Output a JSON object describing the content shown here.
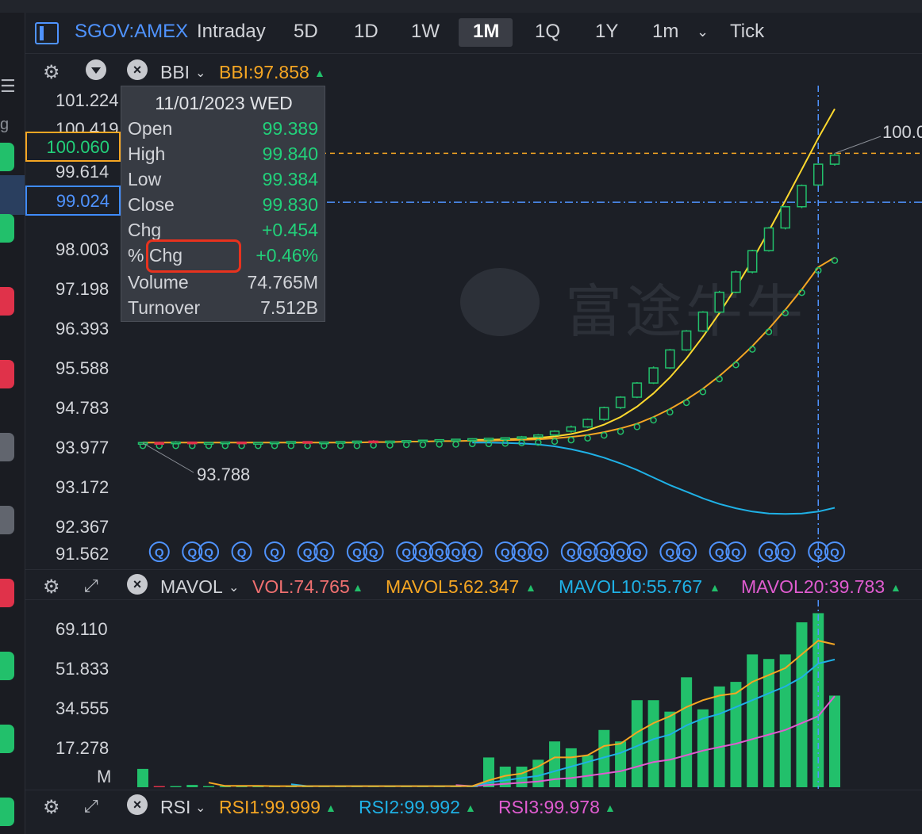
{
  "toolbar": {
    "symbol": "SGOV:AMEX",
    "timeframes": [
      "Intraday",
      "5D",
      "1D",
      "1W",
      "1M",
      "1Q",
      "1Y",
      "1m",
      "Tick"
    ],
    "active_timeframe": "1M"
  },
  "rail": {
    "menu_glyph": "☰",
    "letter": "g"
  },
  "price_panel": {
    "indicator": "BBI",
    "indicator_value": "BBI:97.858",
    "y_ticks": [
      "101.224",
      "100.419",
      "99.614",
      "98.003",
      "97.198",
      "96.393",
      "95.588",
      "94.783",
      "93.977",
      "93.172",
      "92.367",
      "91.562"
    ],
    "high_tag": "100.060",
    "low_tag": "99.024",
    "min_label": "93.788",
    "max_label": "100.0",
    "watermark": "富途牛牛"
  },
  "tooltip": {
    "date": "11/01/2023 WED",
    "rows": [
      {
        "label": "Open",
        "value": "99.389"
      },
      {
        "label": "High",
        "value": "99.840"
      },
      {
        "label": "Low",
        "value": "99.384"
      },
      {
        "label": "Close",
        "value": "99.830"
      },
      {
        "label": "Chg",
        "value": "+0.454"
      },
      {
        "label": "% Chg",
        "value": "+0.46%"
      },
      {
        "label": "Volume",
        "value": "74.765M"
      },
      {
        "label": "Turnover",
        "value": "7.512B"
      }
    ]
  },
  "vol_panel": {
    "indicator": "MAVOL",
    "vol": "VOL:74.765",
    "mavol5": "MAVOL5:62.347",
    "mavol10": "MAVOL10:55.767",
    "mavol20": "MAVOL20:39.783",
    "y_ticks": [
      "69.110",
      "51.833",
      "34.555",
      "17.278",
      "M"
    ]
  },
  "rsi_panel": {
    "indicator": "RSI",
    "rsi1": "RSI1:99.999",
    "rsi2": "RSI2:99.992",
    "rsi3": "RSI3:99.978"
  },
  "colors": {
    "up": "#22c06b",
    "down": "#e0324a",
    "accent": "#4f93ff",
    "orange": "#f5a623",
    "cyan": "#1fb1e6",
    "pink": "#e05cd0",
    "yellow": "#ffd92e"
  },
  "chart_data": {
    "type": "candlestick",
    "price_panel": {
      "ylim": [
        91.562,
        101.224
      ],
      "candles": [
        [
          93.93,
          93.95,
          93.9,
          93.94
        ],
        [
          93.94,
          93.96,
          93.91,
          93.93
        ],
        [
          93.93,
          93.97,
          93.9,
          93.95
        ],
        [
          93.95,
          93.96,
          93.9,
          93.93
        ],
        [
          93.93,
          93.95,
          93.91,
          93.94
        ],
        [
          93.94,
          93.96,
          93.92,
          93.95
        ],
        [
          93.95,
          93.96,
          93.92,
          93.93
        ],
        [
          93.93,
          93.95,
          93.91,
          93.94
        ],
        [
          93.94,
          93.96,
          93.92,
          93.95
        ],
        [
          93.95,
          93.97,
          93.93,
          93.96
        ],
        [
          93.96,
          93.97,
          93.93,
          93.94
        ],
        [
          93.94,
          93.96,
          93.92,
          93.95
        ],
        [
          93.95,
          93.97,
          93.93,
          93.96
        ],
        [
          93.96,
          93.98,
          93.94,
          93.97
        ],
        [
          93.97,
          93.99,
          93.95,
          93.96
        ],
        [
          93.96,
          93.98,
          93.94,
          93.97
        ],
        [
          93.97,
          93.99,
          93.95,
          93.98
        ],
        [
          93.98,
          94.0,
          93.96,
          93.99
        ],
        [
          93.99,
          94.01,
          93.97,
          94.0
        ],
        [
          94.0,
          94.02,
          93.98,
          94.01
        ],
        [
          94.01,
          94.03,
          93.99,
          94.02
        ],
        [
          94.02,
          94.04,
          94.0,
          94.03
        ],
        [
          94.03,
          94.05,
          94.01,
          94.04
        ],
        [
          94.04,
          94.08,
          94.02,
          94.06
        ],
        [
          94.06,
          94.12,
          94.04,
          94.1
        ],
        [
          94.1,
          94.2,
          94.08,
          94.18
        ],
        [
          94.18,
          94.3,
          94.15,
          94.27
        ],
        [
          94.27,
          94.45,
          94.25,
          94.43
        ],
        [
          94.43,
          94.7,
          94.4,
          94.68
        ],
        [
          94.68,
          94.92,
          94.65,
          94.9
        ],
        [
          94.9,
          95.22,
          94.88,
          95.2
        ],
        [
          95.2,
          95.55,
          95.18,
          95.52
        ],
        [
          95.52,
          95.92,
          95.5,
          95.9
        ],
        [
          95.9,
          96.32,
          95.88,
          96.3
        ],
        [
          96.3,
          96.72,
          96.28,
          96.7
        ],
        [
          96.7,
          97.15,
          96.68,
          97.12
        ],
        [
          97.12,
          97.58,
          97.1,
          97.55
        ],
        [
          97.55,
          98.02,
          97.52,
          98.0
        ],
        [
          98.0,
          98.5,
          97.98,
          98.48
        ],
        [
          98.48,
          98.95,
          98.45,
          98.93
        ],
        [
          98.93,
          99.4,
          98.9,
          99.38
        ],
        [
          99.389,
          99.84,
          99.384,
          99.83
        ],
        [
          99.83,
          100.06,
          99.8,
          100.02
        ]
      ],
      "bbi": [
        93.94,
        93.94,
        93.94,
        93.94,
        93.94,
        93.94,
        93.94,
        93.94,
        93.94,
        93.94,
        93.94,
        93.94,
        93.94,
        93.94,
        93.95,
        93.95,
        93.96,
        93.96,
        93.97,
        93.97,
        93.98,
        93.98,
        93.99,
        94.0,
        94.01,
        94.03,
        94.06,
        94.1,
        94.16,
        94.24,
        94.34,
        94.48,
        94.65,
        94.85,
        95.08,
        95.35,
        95.65,
        95.98,
        96.35,
        96.75,
        97.18,
        97.65,
        97.858
      ],
      "upper": [
        null,
        null,
        null,
        null,
        null,
        null,
        null,
        null,
        null,
        null,
        null,
        null,
        null,
        null,
        null,
        null,
        null,
        null,
        null,
        null,
        94.0,
        94.0,
        94.01,
        94.02,
        94.04,
        94.07,
        94.12,
        94.2,
        94.32,
        94.48,
        94.7,
        94.98,
        95.32,
        95.72,
        96.18,
        96.68,
        97.22,
        97.8,
        98.42,
        99.06,
        99.72,
        100.38,
        101.0
      ],
      "lower": [
        null,
        null,
        null,
        null,
        null,
        null,
        null,
        null,
        null,
        null,
        null,
        null,
        null,
        null,
        null,
        null,
        null,
        null,
        null,
        null,
        93.94,
        93.94,
        93.93,
        93.92,
        93.9,
        93.86,
        93.8,
        93.72,
        93.62,
        93.5,
        93.36,
        93.2,
        93.04,
        92.9,
        92.76,
        92.64,
        92.55,
        92.48,
        92.44,
        92.43,
        92.44,
        92.48,
        92.56
      ]
    },
    "volume_panel": {
      "ylim": [
        0,
        74.765
      ],
      "volumes": [
        8,
        0.5,
        0.5,
        1,
        0.5,
        0.5,
        0.5,
        0.5,
        0.5,
        0.5,
        0.5,
        0.5,
        0.5,
        0.5,
        0.5,
        0.5,
        0.5,
        0.5,
        0.5,
        0.5,
        0.5,
        13,
        9,
        9,
        12,
        20,
        17,
        14,
        25,
        20,
        38,
        38,
        33,
        48,
        34,
        44,
        46,
        58,
        56,
        58,
        72,
        76,
        40
      ],
      "mavol5": [
        null,
        null,
        null,
        null,
        2,
        0.6,
        0.6,
        0.6,
        0.5,
        0.5,
        0.5,
        0.5,
        0.5,
        0.5,
        0.5,
        0.5,
        0.5,
        0.5,
        0.5,
        0.5,
        0.5,
        3,
        5,
        6,
        9,
        13,
        13,
        14,
        18,
        19,
        24,
        28,
        31,
        35,
        38,
        40,
        41,
        46,
        49,
        52,
        58,
        64,
        62.347
      ],
      "mavol10": [
        null,
        null,
        null,
        null,
        null,
        null,
        null,
        null,
        null,
        1.3,
        0.5,
        0.5,
        0.5,
        0.5,
        0.5,
        0.5,
        0.5,
        0.5,
        0.5,
        0.5,
        0.5,
        2,
        3,
        4,
        5,
        7,
        9,
        11,
        13,
        15,
        18,
        21,
        23,
        27,
        30,
        32,
        35,
        38,
        41,
        44,
        48,
        54,
        55.767
      ],
      "mavol20": [
        null,
        null,
        null,
        null,
        null,
        null,
        null,
        null,
        null,
        null,
        null,
        null,
        null,
        null,
        null,
        null,
        null,
        null,
        null,
        0.9,
        0.5,
        1,
        1.5,
        2,
        2.5,
        3.5,
        4,
        5,
        6,
        7,
        9,
        11,
        12,
        14,
        16,
        17.5,
        19,
        21,
        23,
        25,
        28,
        31,
        39.783
      ]
    }
  }
}
